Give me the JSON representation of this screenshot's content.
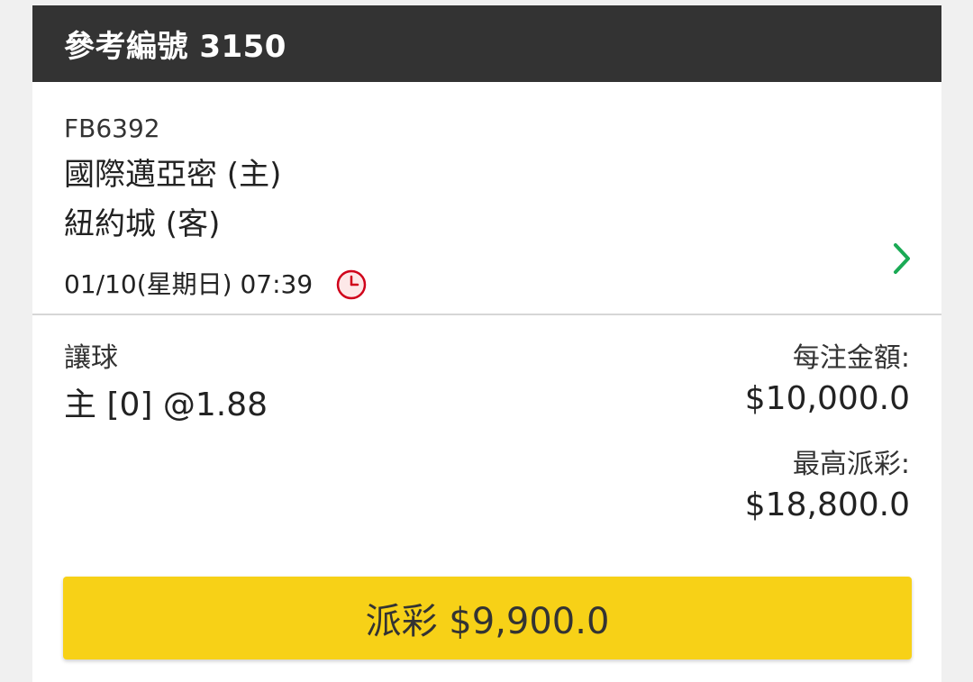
{
  "header": {
    "title": "參考編號 3150"
  },
  "match": {
    "id": "FB6392",
    "home_team": "國際邁亞密 (主)",
    "away_team": "紐約城 (客)",
    "datetime": "01/10(星期日) 07:39",
    "clock_icon": "clock-icon",
    "chevron_icon": "chevron-right-icon"
  },
  "bet": {
    "type": "讓球",
    "selection": "主 [0] @1.88",
    "stake_label": "每注金額:",
    "stake_value": "$10,000.0",
    "max_payout_label": "最高派彩:",
    "max_payout_value": "$18,800.0"
  },
  "payout_button": {
    "label": "派彩 $9,900.0"
  },
  "colors": {
    "header_bg": "#333333",
    "button_bg": "#f7d117",
    "chevron": "#1aaa55",
    "clock": "#d0021b"
  }
}
